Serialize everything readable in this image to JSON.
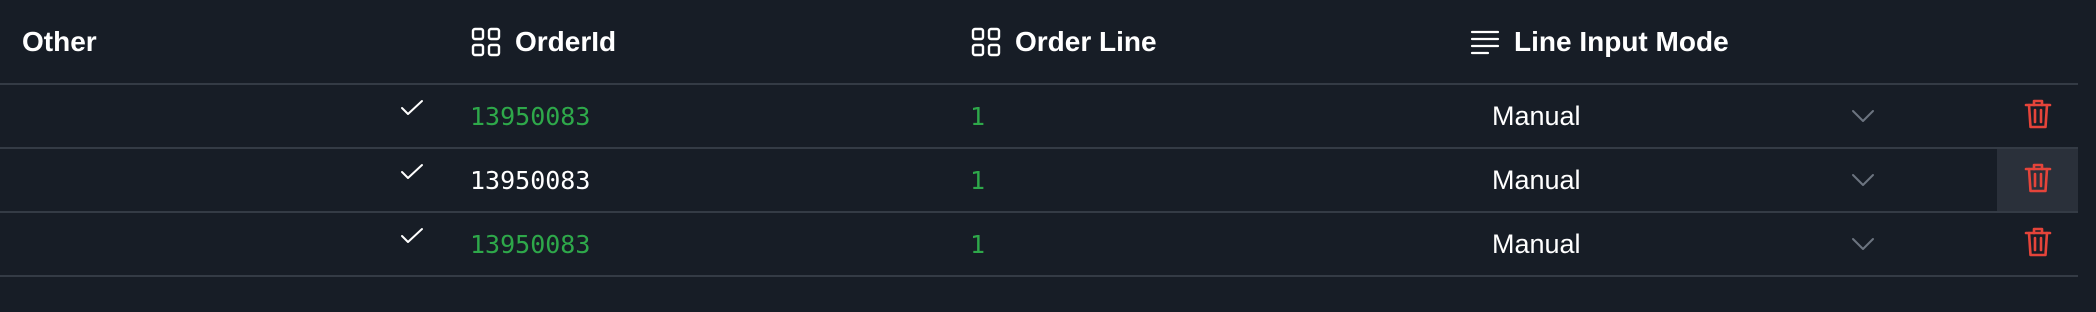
{
  "table": {
    "columns": {
      "other": "Other",
      "order_id": "OrderId",
      "order_line": "Order Line",
      "line_input_mode": "Line Input Mode"
    },
    "rows": [
      {
        "checked": true,
        "order_id": "13950083",
        "order_id_color": "#2ea84a",
        "order_line": "1",
        "line_input_mode": "Manual"
      },
      {
        "checked": true,
        "order_id": "13950083",
        "order_id_color": "#ffffff",
        "order_line": "1",
        "line_input_mode": "Manual"
      },
      {
        "checked": true,
        "order_id": "13950083",
        "order_id_color": "#2ea84a",
        "order_line": "1",
        "line_input_mode": "Manual"
      }
    ]
  },
  "colors": {
    "background": "#171d26",
    "divider": "#343b45",
    "accent_green": "#2ea84a",
    "delete_red": "#e5443a",
    "hover_row_action": "#2a303a"
  },
  "icons": {
    "order_id_header": "grid-icon",
    "order_line_header": "grid-icon",
    "mode_header": "lines-icon",
    "row_check": "check-icon",
    "row_dropdown": "chevron-down-icon",
    "row_delete": "trash-icon"
  }
}
